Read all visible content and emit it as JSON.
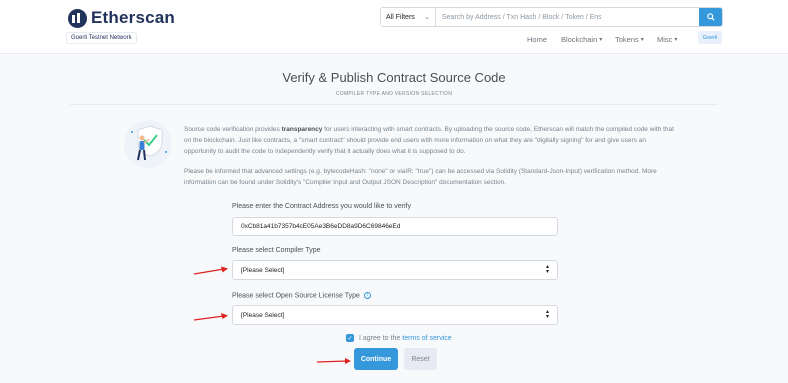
{
  "header": {
    "logo_text": "Etherscan",
    "network_badge": "Goerli Testnet Network",
    "search": {
      "filter": "All Filters",
      "placeholder": "Search by Address / Txn Hash / Block / Token / Ens"
    },
    "nav": {
      "home": "Home",
      "blockchain": "Blockchain",
      "tokens": "Tokens",
      "misc": "Misc",
      "network": "Goerli"
    }
  },
  "main": {
    "title": "Verify & Publish Contract Source Code",
    "subtitle": "COMPILER TYPE AND VERSION SELECTION",
    "info": {
      "p1_before": "Source code verification provides ",
      "p1_bold": "transparency",
      "p1_after": " for users interacting with smart contracts. By uploading the source code, Etherscan will match the compiled code with that on the blockchain. Just like contracts, a \"smart contract\" should provide end users with more information on what they are \"digitally signing\" for and give users an opportunity to audit the code to independently verify that it actually does what it is supposed to do.",
      "p2": "Please be informed that advanced settings (e.g. bytecodeHash: \"none\" or viaIR: \"true\") can be accessed via Solidity (Standard-Json-Input) verification method. More information can be found under Solidity's \"Compiler Input and Output JSON Description\" documentation section."
    },
    "form": {
      "address_label": "Please enter the Contract Address you would like to verify",
      "address_value": "0xCb81a41b7357b4cE05Ae3B6eDD8a9D6C69846eEd",
      "compiler_label": "Please select Compiler Type",
      "compiler_value": "[Please Select]",
      "license_label": "Please select Open Source License Type",
      "license_value": "[Please Select]",
      "agree_text": "I agree to the",
      "agree_link": "terms of service",
      "continue_label": "Continue",
      "reset_label": "Reset"
    }
  },
  "colors": {
    "accent": "#3498db",
    "brand": "#21325b",
    "annotation_arrow": "#e02020"
  }
}
